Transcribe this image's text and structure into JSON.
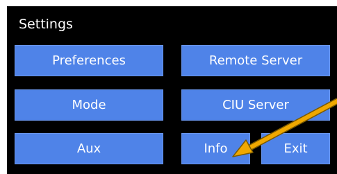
{
  "panel": {
    "title": "Settings"
  },
  "buttons": {
    "preferences": "Preferences",
    "remote_server": "Remote Server",
    "mode": "Mode",
    "ciu_server": "CIU Server",
    "aux": "Aux",
    "info": "Info",
    "exit": "Exit"
  },
  "colors": {
    "panel_bg": "#000000",
    "button_bg": "#4f83e8",
    "button_text": "#ffffff",
    "arrow": "#f0a800"
  },
  "annotation": {
    "icon": "arrow-pointing-to-info"
  }
}
